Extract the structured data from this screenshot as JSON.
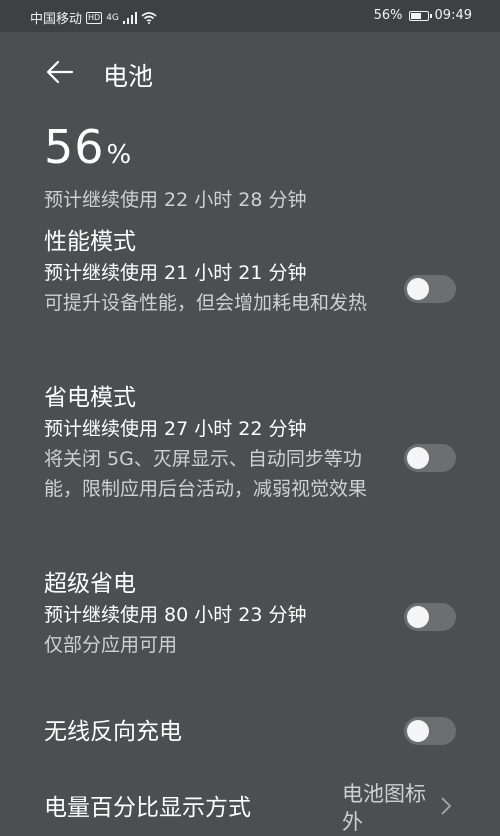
{
  "status_bar": {
    "carrier": "中国移动",
    "hd_badge": "HD",
    "network": "4G",
    "battery_text": "56%",
    "battery_level": 0.56,
    "time": "09:49"
  },
  "header": {
    "title": "电池"
  },
  "battery": {
    "percent_number": "56",
    "percent_sign": "%",
    "estimate": "预计继续使用 22 小时 28 分钟"
  },
  "settings": [
    {
      "title": "性能模式",
      "subtitle": "预计继续使用 21 小时 21 分钟",
      "description": "可提升设备性能，但会增加耗电和发热",
      "enabled": false
    },
    {
      "title": "省电模式",
      "subtitle": "预计继续使用 27 小时 22 分钟",
      "description": "将关闭 5G、灭屏显示、自动同步等功能，限制应用后台活动，减弱视觉效果",
      "enabled": false
    },
    {
      "title": "超级省电",
      "subtitle": "预计继续使用 80 小时 23 分钟",
      "description": "仅部分应用可用",
      "enabled": false
    },
    {
      "title": "无线反向充电",
      "enabled": false
    }
  ],
  "display_mode": {
    "label": "电量百分比显示方式",
    "value": "电池图标外"
  },
  "colors": {
    "background": "#4c4e51",
    "status_bar": "#3e4043",
    "toggle_off_track": "#6c6e71",
    "toggle_knob": "#f5f5f5"
  }
}
